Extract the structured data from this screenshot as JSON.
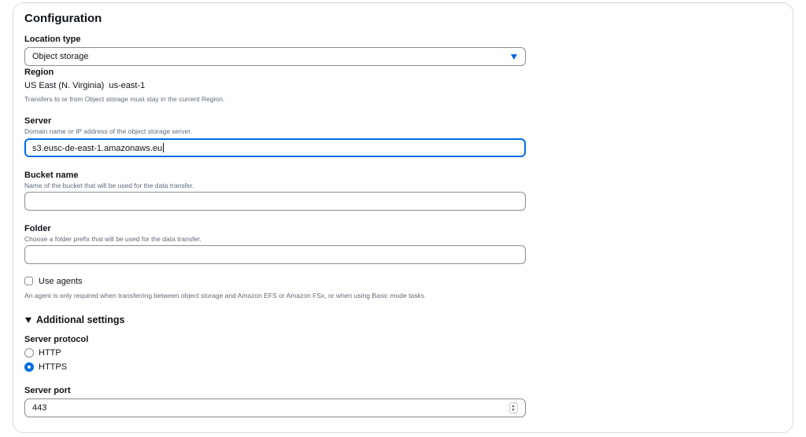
{
  "section": {
    "title": "Configuration"
  },
  "location_type": {
    "label": "Location type",
    "value": "Object storage",
    "icon": "caret-down-icon"
  },
  "region": {
    "label": "Region",
    "name": "US East (N. Virginia)",
    "code": "us-east-1",
    "note": "Transfers to or from Object storage must stay in the current Region."
  },
  "server": {
    "label": "Server",
    "description": "Domain name or IP address of the object storage server.",
    "value": "s3.eusc-de-east-1.amazonaws.eu"
  },
  "bucket": {
    "label": "Bucket name",
    "description": "Name of the bucket that will be used for the data transfer.",
    "value": ""
  },
  "folder": {
    "label": "Folder",
    "description": "Choose a folder prefix that will be used for the data transfer.",
    "value": ""
  },
  "agents": {
    "label": "Use agents",
    "checked": false,
    "description": "An agent is only required when transferring between object storage and Amazon EFS or Amazon FSx, or when using Basic mode tasks."
  },
  "additional": {
    "label": "Additional settings",
    "expanded": true
  },
  "protocol": {
    "label": "Server protocol",
    "options": [
      "HTTP",
      "HTTPS"
    ],
    "selected": "HTTPS"
  },
  "port": {
    "label": "Server port",
    "value": "443"
  },
  "colors": {
    "accent": "#006ce0",
    "border": "#8c8c94",
    "text": "#0f141a",
    "muted": "#5f6b7a"
  }
}
